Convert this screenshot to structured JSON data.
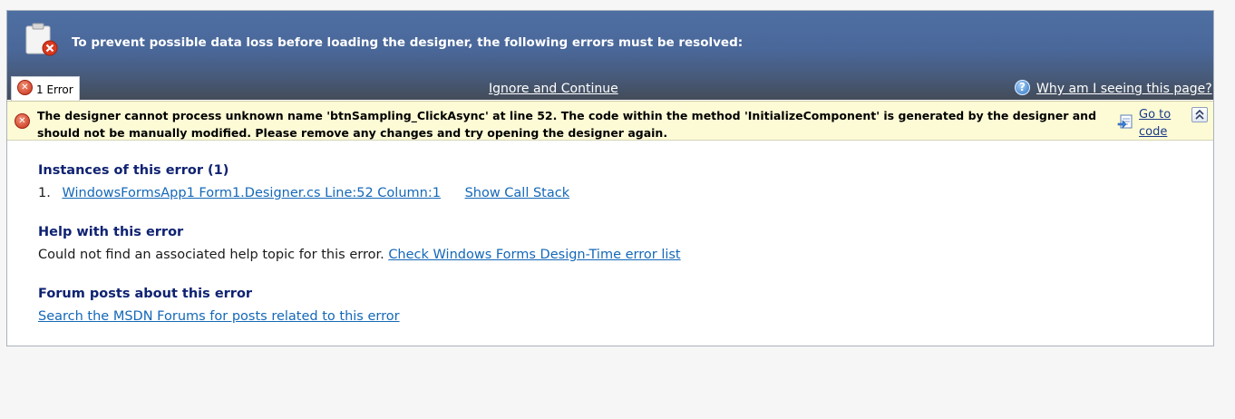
{
  "header": {
    "title": "To prevent possible data loss before loading the designer, the following errors must be resolved:"
  },
  "tabs": [
    {
      "label": "1 Error"
    }
  ],
  "toolbar": {
    "ignore_label": "Ignore and Continue",
    "why_label": "Why am I seeing this page?"
  },
  "error": {
    "message": "The designer cannot process unknown name 'btnSampling_ClickAsync' at line 52. The code within the method 'InitializeComponent' is generated by the designer and should not be manually modified. Please remove any changes and try opening the designer again.",
    "goto_label": "Go to code"
  },
  "instances": {
    "title": "Instances of this error (1)",
    "items": [
      {
        "number": "1.",
        "location": "WindowsFormsApp1 Form1.Designer.cs Line:52 Column:1",
        "call_stack_label": "Show Call Stack"
      }
    ]
  },
  "help": {
    "title": "Help with this error",
    "text": "Could not find an associated help topic for this error.",
    "link_label": "Check Windows Forms Design-Time error list"
  },
  "forum": {
    "title": "Forum posts about this error",
    "link_label": "Search the MSDN Forums for posts related to this error"
  },
  "colors": {
    "header_top": "#4e6fa3",
    "header_bottom": "#434c59",
    "banner_bg": "#fdfbd5",
    "section_title": "#0f2272",
    "link": "#1468b8"
  }
}
